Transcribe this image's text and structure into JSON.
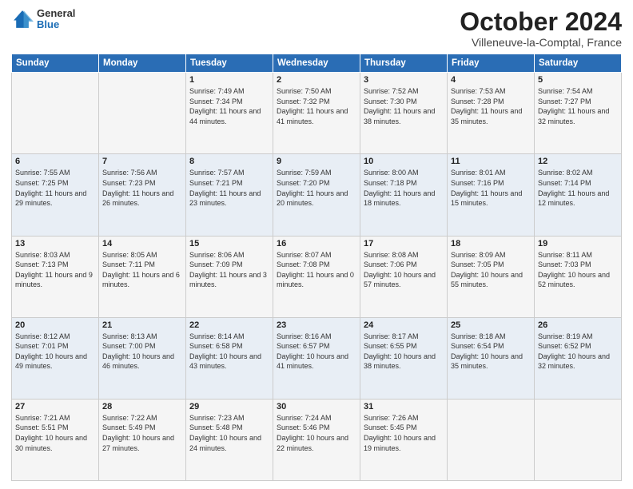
{
  "header": {
    "logo_general": "General",
    "logo_blue": "Blue",
    "month": "October 2024",
    "location": "Villeneuve-la-Comptal, France"
  },
  "weekdays": [
    "Sunday",
    "Monday",
    "Tuesday",
    "Wednesday",
    "Thursday",
    "Friday",
    "Saturday"
  ],
  "weeks": [
    [
      {
        "day": "",
        "info": ""
      },
      {
        "day": "",
        "info": ""
      },
      {
        "day": "1",
        "info": "Sunrise: 7:49 AM\nSunset: 7:34 PM\nDaylight: 11 hours and 44 minutes."
      },
      {
        "day": "2",
        "info": "Sunrise: 7:50 AM\nSunset: 7:32 PM\nDaylight: 11 hours and 41 minutes."
      },
      {
        "day": "3",
        "info": "Sunrise: 7:52 AM\nSunset: 7:30 PM\nDaylight: 11 hours and 38 minutes."
      },
      {
        "day": "4",
        "info": "Sunrise: 7:53 AM\nSunset: 7:28 PM\nDaylight: 11 hours and 35 minutes."
      },
      {
        "day": "5",
        "info": "Sunrise: 7:54 AM\nSunset: 7:27 PM\nDaylight: 11 hours and 32 minutes."
      }
    ],
    [
      {
        "day": "6",
        "info": "Sunrise: 7:55 AM\nSunset: 7:25 PM\nDaylight: 11 hours and 29 minutes."
      },
      {
        "day": "7",
        "info": "Sunrise: 7:56 AM\nSunset: 7:23 PM\nDaylight: 11 hours and 26 minutes."
      },
      {
        "day": "8",
        "info": "Sunrise: 7:57 AM\nSunset: 7:21 PM\nDaylight: 11 hours and 23 minutes."
      },
      {
        "day": "9",
        "info": "Sunrise: 7:59 AM\nSunset: 7:20 PM\nDaylight: 11 hours and 20 minutes."
      },
      {
        "day": "10",
        "info": "Sunrise: 8:00 AM\nSunset: 7:18 PM\nDaylight: 11 hours and 18 minutes."
      },
      {
        "day": "11",
        "info": "Sunrise: 8:01 AM\nSunset: 7:16 PM\nDaylight: 11 hours and 15 minutes."
      },
      {
        "day": "12",
        "info": "Sunrise: 8:02 AM\nSunset: 7:14 PM\nDaylight: 11 hours and 12 minutes."
      }
    ],
    [
      {
        "day": "13",
        "info": "Sunrise: 8:03 AM\nSunset: 7:13 PM\nDaylight: 11 hours and 9 minutes."
      },
      {
        "day": "14",
        "info": "Sunrise: 8:05 AM\nSunset: 7:11 PM\nDaylight: 11 hours and 6 minutes."
      },
      {
        "day": "15",
        "info": "Sunrise: 8:06 AM\nSunset: 7:09 PM\nDaylight: 11 hours and 3 minutes."
      },
      {
        "day": "16",
        "info": "Sunrise: 8:07 AM\nSunset: 7:08 PM\nDaylight: 11 hours and 0 minutes."
      },
      {
        "day": "17",
        "info": "Sunrise: 8:08 AM\nSunset: 7:06 PM\nDaylight: 10 hours and 57 minutes."
      },
      {
        "day": "18",
        "info": "Sunrise: 8:09 AM\nSunset: 7:05 PM\nDaylight: 10 hours and 55 minutes."
      },
      {
        "day": "19",
        "info": "Sunrise: 8:11 AM\nSunset: 7:03 PM\nDaylight: 10 hours and 52 minutes."
      }
    ],
    [
      {
        "day": "20",
        "info": "Sunrise: 8:12 AM\nSunset: 7:01 PM\nDaylight: 10 hours and 49 minutes."
      },
      {
        "day": "21",
        "info": "Sunrise: 8:13 AM\nSunset: 7:00 PM\nDaylight: 10 hours and 46 minutes."
      },
      {
        "day": "22",
        "info": "Sunrise: 8:14 AM\nSunset: 6:58 PM\nDaylight: 10 hours and 43 minutes."
      },
      {
        "day": "23",
        "info": "Sunrise: 8:16 AM\nSunset: 6:57 PM\nDaylight: 10 hours and 41 minutes."
      },
      {
        "day": "24",
        "info": "Sunrise: 8:17 AM\nSunset: 6:55 PM\nDaylight: 10 hours and 38 minutes."
      },
      {
        "day": "25",
        "info": "Sunrise: 8:18 AM\nSunset: 6:54 PM\nDaylight: 10 hours and 35 minutes."
      },
      {
        "day": "26",
        "info": "Sunrise: 8:19 AM\nSunset: 6:52 PM\nDaylight: 10 hours and 32 minutes."
      }
    ],
    [
      {
        "day": "27",
        "info": "Sunrise: 7:21 AM\nSunset: 5:51 PM\nDaylight: 10 hours and 30 minutes."
      },
      {
        "day": "28",
        "info": "Sunrise: 7:22 AM\nSunset: 5:49 PM\nDaylight: 10 hours and 27 minutes."
      },
      {
        "day": "29",
        "info": "Sunrise: 7:23 AM\nSunset: 5:48 PM\nDaylight: 10 hours and 24 minutes."
      },
      {
        "day": "30",
        "info": "Sunrise: 7:24 AM\nSunset: 5:46 PM\nDaylight: 10 hours and 22 minutes."
      },
      {
        "day": "31",
        "info": "Sunrise: 7:26 AM\nSunset: 5:45 PM\nDaylight: 10 hours and 19 minutes."
      },
      {
        "day": "",
        "info": ""
      },
      {
        "day": "",
        "info": ""
      }
    ]
  ]
}
